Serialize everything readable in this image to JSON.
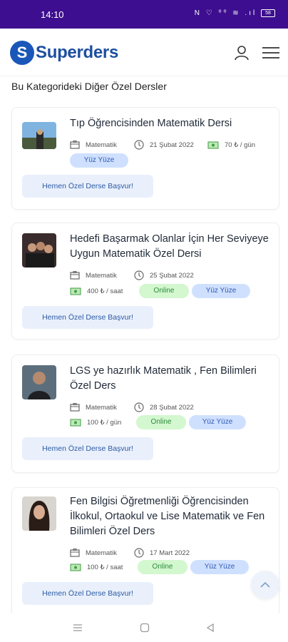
{
  "status_bar": {
    "time": "14:10",
    "icons_text": "N ♡ ⁰⁰ ≋ .ıl",
    "battery": "58"
  },
  "header": {
    "logo_letter": "S",
    "logo_text": "Superders"
  },
  "section_title": "Bu Kategorideki Diğer Özel Dersler",
  "cards": [
    {
      "title": "Tıp Öğrencisinden Matematik Dersi",
      "subject": "Matematik",
      "date": "21 Şubat 2022",
      "price": "70 ₺ / gün",
      "badges": [
        "Yüz Yüze"
      ],
      "apply": "Hemen Özel Derse Başvur!"
    },
    {
      "title": "Hedefi Başarmak Olanlar İçin Her Seviyeye Uygun Matematik Özel Dersi",
      "subject": "Matematik",
      "date": "25 Şubat 2022",
      "price": "400 ₺ / saat",
      "badges": [
        "Online",
        "Yüz Yüze"
      ],
      "apply": "Hemen Özel Derse Başvur!"
    },
    {
      "title": "LGS ye hazırlık Matematik , Fen Bilimleri Özel Ders",
      "subject": "Matematik",
      "date": "28 Şubat 2022",
      "price": "100 ₺ / gün",
      "badges": [
        "Online",
        "Yüz Yüze"
      ],
      "apply": "Hemen Özel Derse Başvur!"
    },
    {
      "title": "Fen Bilgisi Öğretmenliği Öğrencisinden İlkokul, Ortaokul ve Lise Matematik ve Fen Bilimleri Özel Ders",
      "subject": "Matematik",
      "date": "17 Mart 2022",
      "price": "100 ₺ / saat",
      "badges": [
        "Online",
        "Yüz Yüze"
      ],
      "apply": "Hemen Özel Derse Başvur!"
    }
  ],
  "colors": {
    "status_bar": "#3d0e8f",
    "brand": "#1d4f9e",
    "badge_blue": "#cfe0ff",
    "badge_green": "#d3f7cf",
    "apply_bg": "#e9f0fb"
  },
  "icons": [
    "user-icon",
    "hamburger-menu-icon",
    "book-icon",
    "clock-icon",
    "money-icon",
    "chevron-up-icon",
    "nav-menu-icon",
    "nav-home-icon",
    "nav-back-icon"
  ]
}
